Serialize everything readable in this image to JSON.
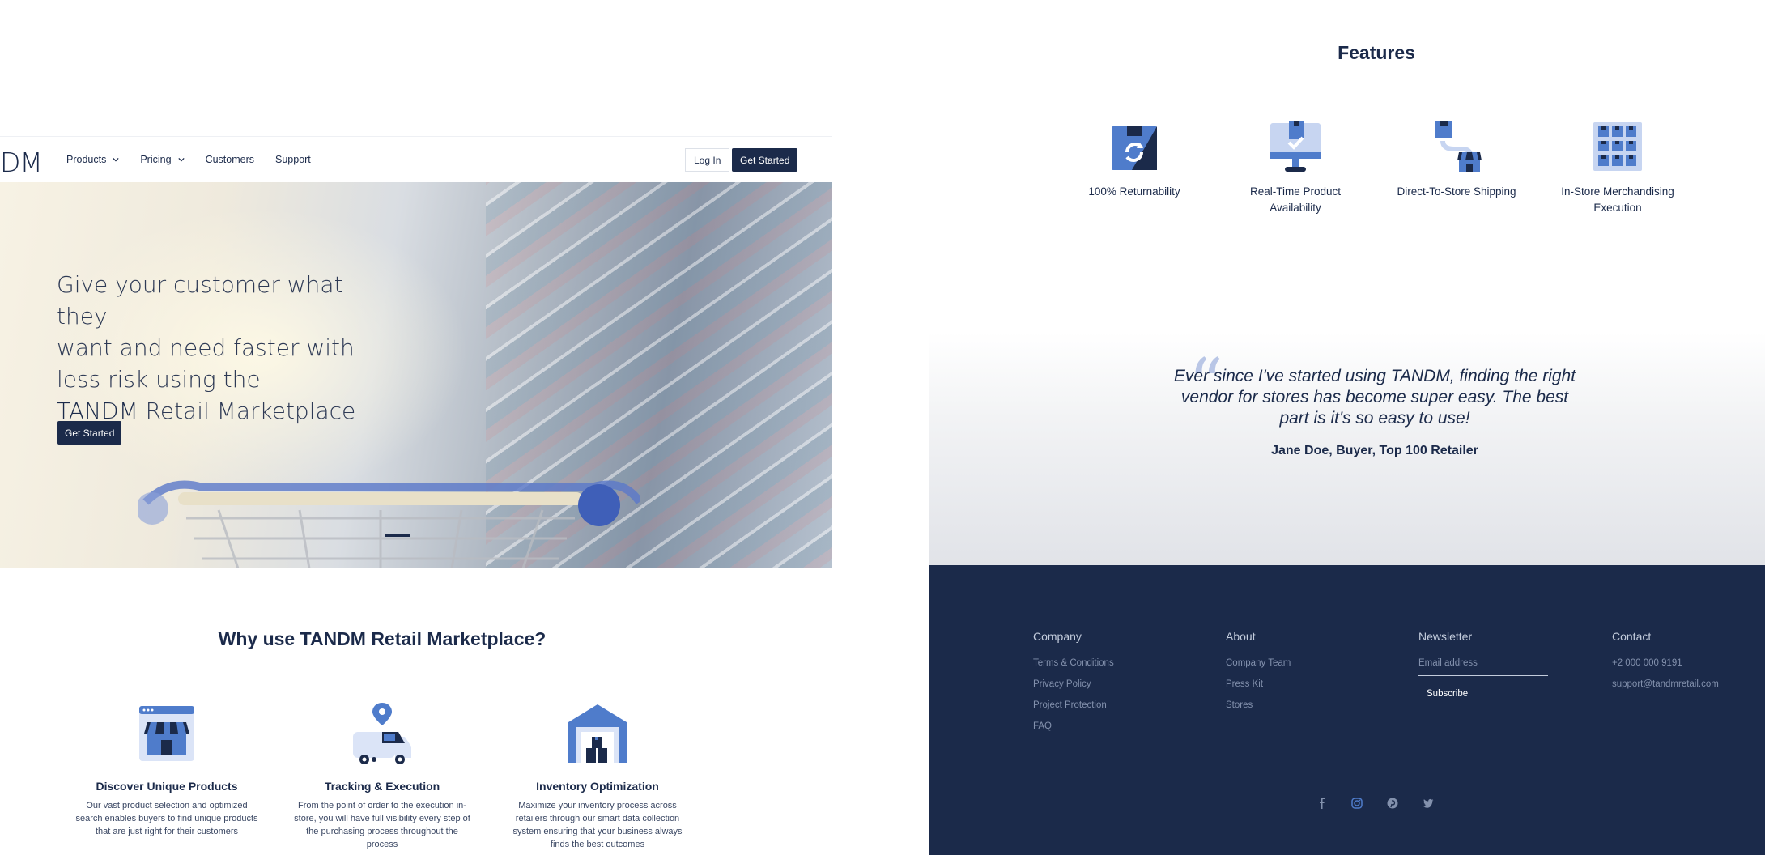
{
  "nav": {
    "logo": "DM",
    "items": [
      {
        "label": "Products",
        "dropdown": true
      },
      {
        "label": "Pricing",
        "dropdown": true
      },
      {
        "label": "Customers",
        "dropdown": false
      },
      {
        "label": "Support",
        "dropdown": false
      }
    ],
    "login_label": "Log In",
    "get_started_label": "Get Started"
  },
  "hero": {
    "line1": "Give your customer what they",
    "line2": "want and need faster with",
    "line3": "less risk using the",
    "brand": "TANDM",
    "line4_rest": "Retail Marketplace",
    "button_label": "Get Started"
  },
  "why": {
    "title": "Why use TANDM Retail Marketplace?",
    "cards": [
      {
        "title": "Discover Unique Products",
        "desc": "Our vast product selection and optimized search enables buyers to find unique products that are just right for their customers",
        "icon": "storefront-icon"
      },
      {
        "title": "Tracking & Execution",
        "desc": "From the point of order to the execution in-store, you will have full visibility every step of the purchasing process throughout the process",
        "icon": "delivery-truck-icon"
      },
      {
        "title": "Inventory Optimization",
        "desc": "Maximize your inventory process across retailers through our smart data collection system ensuring that your business always finds the best outcomes",
        "icon": "warehouse-icon"
      }
    ]
  },
  "features": {
    "title": "Features",
    "items": [
      {
        "label": "100% Returnability",
        "icon": "return-box-icon"
      },
      {
        "label": "Real-Time Product Availability",
        "icon": "monitor-icon"
      },
      {
        "label": "Direct-To-Store Shipping",
        "icon": "shipping-store-icon"
      },
      {
        "label": "In-Store Merchandising Execution",
        "icon": "shelf-grid-icon"
      }
    ]
  },
  "testimonial": {
    "quote": "Ever since I've started using TANDM, finding the right vendor for stores has become super easy. The best part is it's so easy to use!",
    "author": "Jane Doe, Buyer, Top 100 Retailer"
  },
  "footer": {
    "company": {
      "heading": "Company",
      "links": [
        "Terms & Conditions",
        "Privacy Policy",
        "Project Protection",
        "FAQ"
      ]
    },
    "about": {
      "heading": "About",
      "links": [
        "Company Team",
        "Press Kit",
        "Stores"
      ]
    },
    "newsletter": {
      "heading": "Newsletter",
      "email_placeholder": "Email address",
      "subscribe_label": "Subscribe"
    },
    "contact": {
      "heading": "Contact",
      "phone": "+2 000 000 9191",
      "email": "support@tandmretail.com"
    },
    "social": [
      "facebook-icon",
      "instagram-icon",
      "pinterest-icon",
      "twitter-icon"
    ]
  },
  "colors": {
    "navy": "#1b2a4a",
    "accent_blue": "#4f7ccb",
    "light_blue": "#b9c6e6"
  }
}
